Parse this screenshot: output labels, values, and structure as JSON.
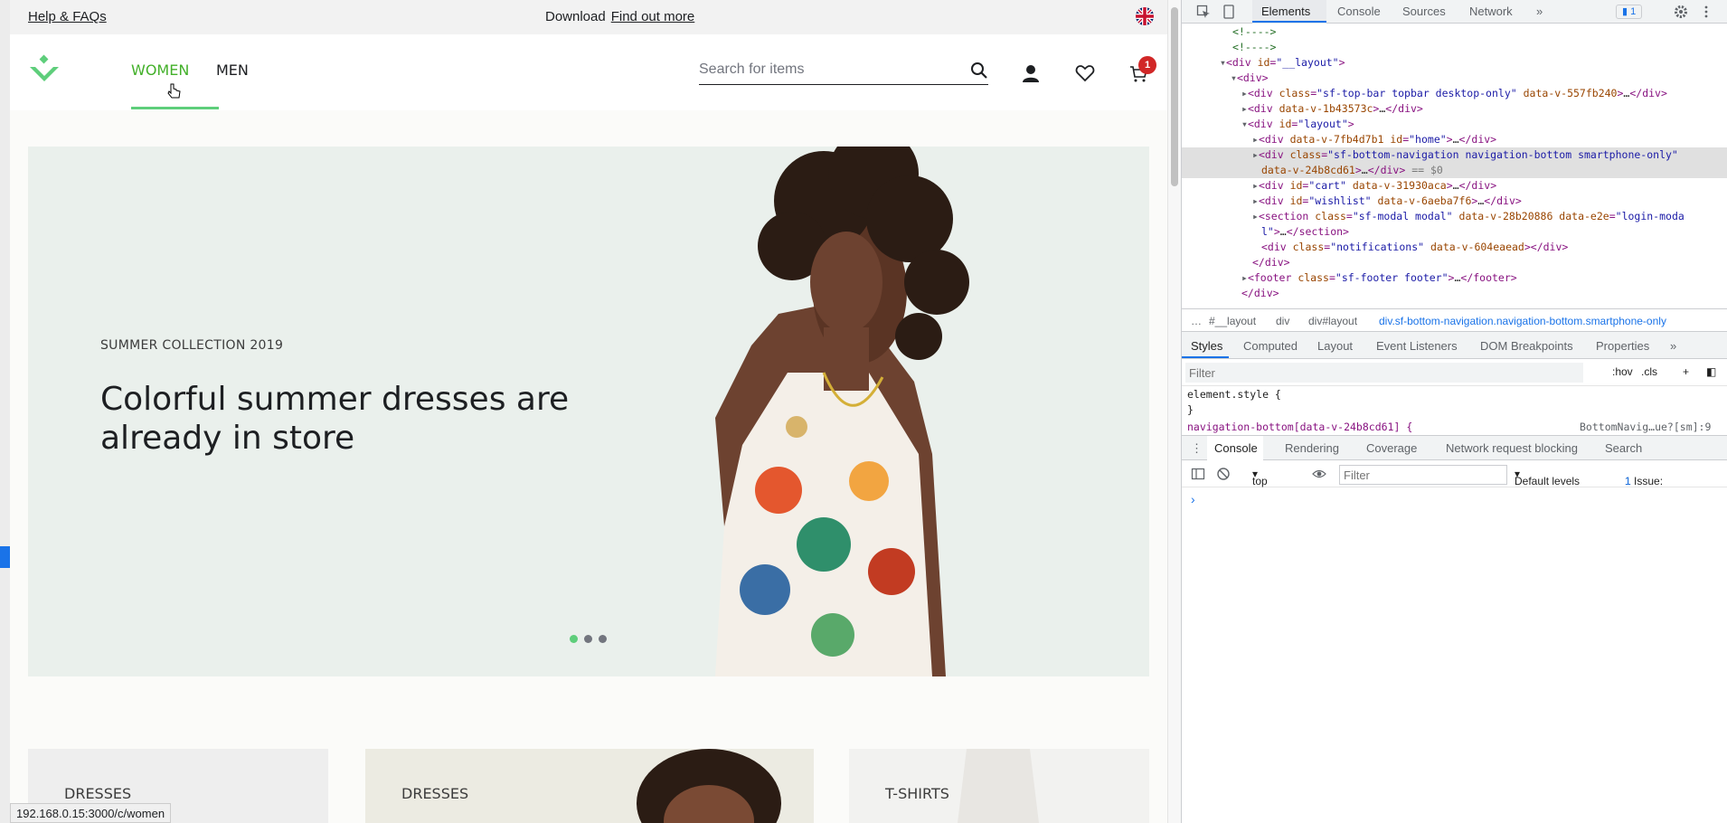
{
  "topbar": {
    "help_label": "Help & FAQs",
    "download_text": "Download",
    "find_out_more": "Find out more",
    "language_icon": "uk-flag-icon"
  },
  "header": {
    "nav_women": "WOMEN",
    "nav_men": "MEN",
    "search_placeholder": "Search for items",
    "cart_count": "1",
    "accent_color": "#5ece7b"
  },
  "hero": {
    "eyebrow": "SUMMER COLLECTION 2019",
    "title": "Colorful summer dresses are already in store",
    "slides": 3,
    "active_slide": 1
  },
  "categories": [
    {
      "label": "DRESSES"
    },
    {
      "label": "DRESSES"
    },
    {
      "label": "T-SHIRTS"
    }
  ],
  "status_url": "192.168.0.15:3000/c/women",
  "devtools": {
    "tabs": [
      "Elements",
      "Console",
      "Sources",
      "Network"
    ],
    "issue_count": "1",
    "crumbs": [
      "#__layout",
      "div",
      "div#layout",
      "div.sf-bottom-navigation.navigation-bottom.smartphone-only"
    ],
    "style_tabs": [
      "Styles",
      "Computed",
      "Layout",
      "Event Listeners",
      "DOM Breakpoints",
      "Properties"
    ],
    "filter_placeholder": "Filter",
    "hov": ":hov",
    "cls": ".cls",
    "element_style": "element.style {",
    "element_style_close": "}",
    "rule_partial": "navigation-bottom[data-v-24b8cd61] {",
    "rule_source": "BottomNavig…ue?[sm]:9",
    "drawer_tabs": [
      "Console",
      "Rendering",
      "Coverage",
      "Network request blocking",
      "Search"
    ],
    "context": "top",
    "console_filter_placeholder": "Filter",
    "levels": "Default levels",
    "issues_label": "1 Issue:",
    "issues_count": "1",
    "prompt": "›"
  }
}
